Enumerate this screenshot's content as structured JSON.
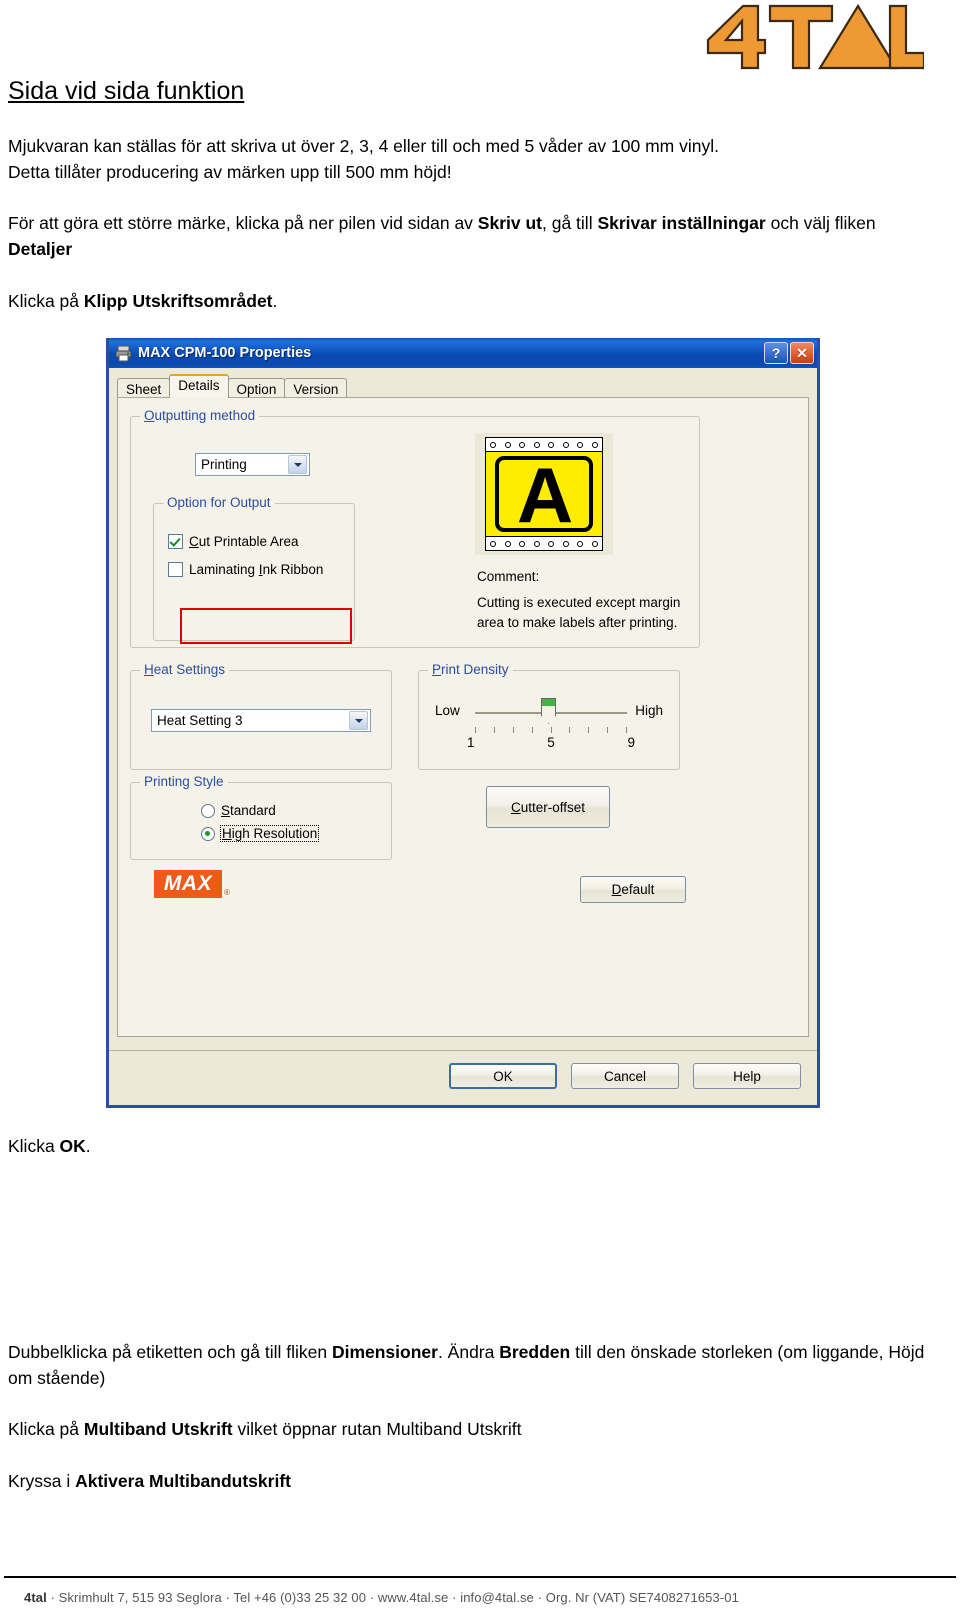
{
  "brand": {
    "logo_text": "4TAL",
    "logo_color": "#ee9933",
    "logo_outline": "#3a2a12"
  },
  "document": {
    "title": "Sida vid sida funktion",
    "paragraph1": {
      "line1": "Mjukvaran kan ställas för att skriva ut över 2, 3, 4 eller till och med 5 våder av 100 mm vinyl.",
      "line2": "Detta tillåter producering av märken upp till 500 mm höjd!"
    },
    "paragraph2": {
      "part1": "För att göra ett större märke, klicka på ner pilen vid sidan av ",
      "bold1": "Skriv ut",
      "part2": ", gå till ",
      "bold2": "Skrivar inställningar",
      "part3": " och välj fliken ",
      "bold3": "Detaljer"
    },
    "paragraph3": {
      "part1": "Klicka på ",
      "bold1": "Klipp Utskriftsområdet",
      "part2": "."
    },
    "paragraph_ok": {
      "part1": "Klicka ",
      "bold1": "OK",
      "part2": "."
    },
    "paragraph4": {
      "part1": "Dubbelklicka på etiketten och gå till fliken ",
      "bold1": "Dimensioner",
      "part2": ". Ändra ",
      "bold2": "Bredden",
      "part3": " till den önskade storleken (om liggande, Höjd om stående)"
    },
    "paragraph5": {
      "part1": "Klicka på ",
      "bold1": "Multiband Utskrift",
      "part2": " vilket öppnar rutan Multiband Utskrift"
    },
    "paragraph6": {
      "part1": "Kryssa i ",
      "bold1": "Aktivera Multibandutskrift"
    }
  },
  "footer": {
    "company": "4tal",
    "rest": " · Skrimhult 7, 515 93 Seglora · Tel +46 (0)33 25 32 00 · www.4tal.se · info@4tal.se · Org. Nr (VAT) SE7408271653-01"
  },
  "dialog": {
    "title": "MAX CPM-100 Properties",
    "help_button": "?",
    "close_button": "✕",
    "tabs": [
      {
        "label": "Sheet",
        "active": false
      },
      {
        "label": "Details",
        "active": true
      },
      {
        "label": "Option",
        "active": false
      },
      {
        "label": "Version",
        "active": false
      }
    ],
    "outputting_method": {
      "group_label": "Outputting method",
      "accel": "O",
      "combo_value": "Printing",
      "option_group_label": "Option for Output",
      "checkbox_cut": {
        "label": "Cut Printable Area",
        "accel": "C",
        "checked": true,
        "highlighted": true
      },
      "checkbox_laminating": {
        "label": "Laminating Ink Ribbon",
        "accel": "I",
        "checked": false
      },
      "comment_label": "Comment:",
      "comment_text": "Cutting is executed except margin area to make labels after printing.",
      "preview_letter": "A",
      "preview_bg_color": "#ffed00"
    },
    "heat_settings": {
      "group_label": "Heat Settings",
      "accel": "H",
      "combo_value": "Heat Setting 3"
    },
    "print_density": {
      "group_label": "Print Density",
      "accel": "P",
      "low_label": "Low",
      "high_label": "High",
      "ticks": [
        "1",
        "5",
        "9"
      ],
      "value": 5,
      "min": 1,
      "max": 9
    },
    "printing_style": {
      "group_label": "Printing Style",
      "options": [
        {
          "label": "Standard",
          "accel": "S",
          "selected": false
        },
        {
          "label": "High Resolution",
          "accel": "H",
          "selected": true
        }
      ]
    },
    "buttons": {
      "cutter_offset": "Cutter-offset",
      "default": "Default",
      "ok": "OK",
      "cancel": "Cancel",
      "help": "Help"
    },
    "vendor_logo": "MAX",
    "vendor_mark": "®"
  }
}
